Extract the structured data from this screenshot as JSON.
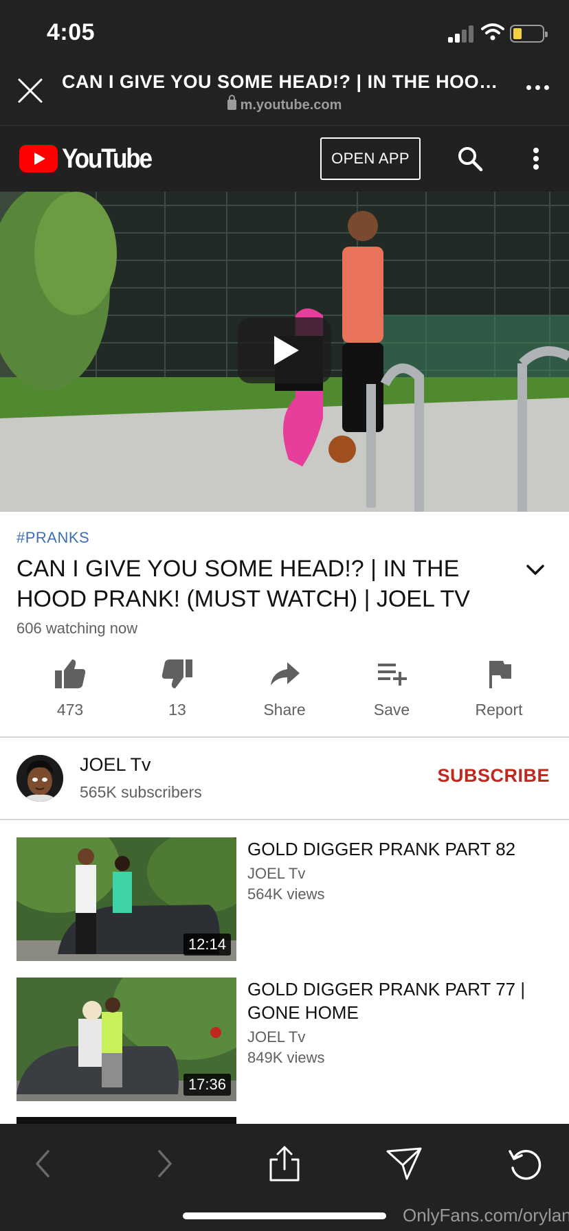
{
  "status_bar": {
    "time": "4:05",
    "battery_level": 0.2
  },
  "browser": {
    "page_title": "CAN I GIVE YOU SOME HEAD!? | IN THE HOOD...",
    "url": "m.youtube.com",
    "icons": [
      "close-icon",
      "lock-icon",
      "more-icon"
    ]
  },
  "yt_header": {
    "logo_text": "YouTube",
    "open_app_label": "OPEN APP",
    "icons": [
      "search-icon",
      "kebab-menu-icon"
    ]
  },
  "video": {
    "hashtag": "#PRANKS",
    "title": "CAN I GIVE YOU SOME HEAD!? | IN THE HOOD PRANK! (MUST WATCH) | JOEL TV",
    "watching": "606 watching now"
  },
  "actions": [
    {
      "label": "473",
      "icon": "thumbs-up-icon"
    },
    {
      "label": "13",
      "icon": "thumbs-down-icon"
    },
    {
      "label": "Share",
      "icon": "share-icon"
    },
    {
      "label": "Save",
      "icon": "save-playlist-icon"
    },
    {
      "label": "Report",
      "icon": "flag-icon"
    }
  ],
  "channel": {
    "name": "JOEL Tv",
    "subscribers": "565K subscribers",
    "subscribe_label": "SUBSCRIBE"
  },
  "recommendations": [
    {
      "title": "GOLD DIGGER PRANK PART 82",
      "channel": "JOEL Tv",
      "views": "564K views",
      "duration": "12:14"
    },
    {
      "title": "GOLD DIGGER PRANK PART 77 | GONE HOME",
      "channel": "JOEL Tv",
      "views": "849K views",
      "duration": "17:36"
    }
  ],
  "toolbar": {
    "icons": [
      "back-icon",
      "forward-icon",
      "share-sheet-icon",
      "send-icon",
      "reload-icon"
    ]
  },
  "watermark": "OnlyFans.com/orylan",
  "colors": {
    "brand_red": "#ff0000",
    "subscribe_red": "#c0281e",
    "hashtag_blue": "#3e6fb5",
    "dark_bar": "#222222"
  }
}
